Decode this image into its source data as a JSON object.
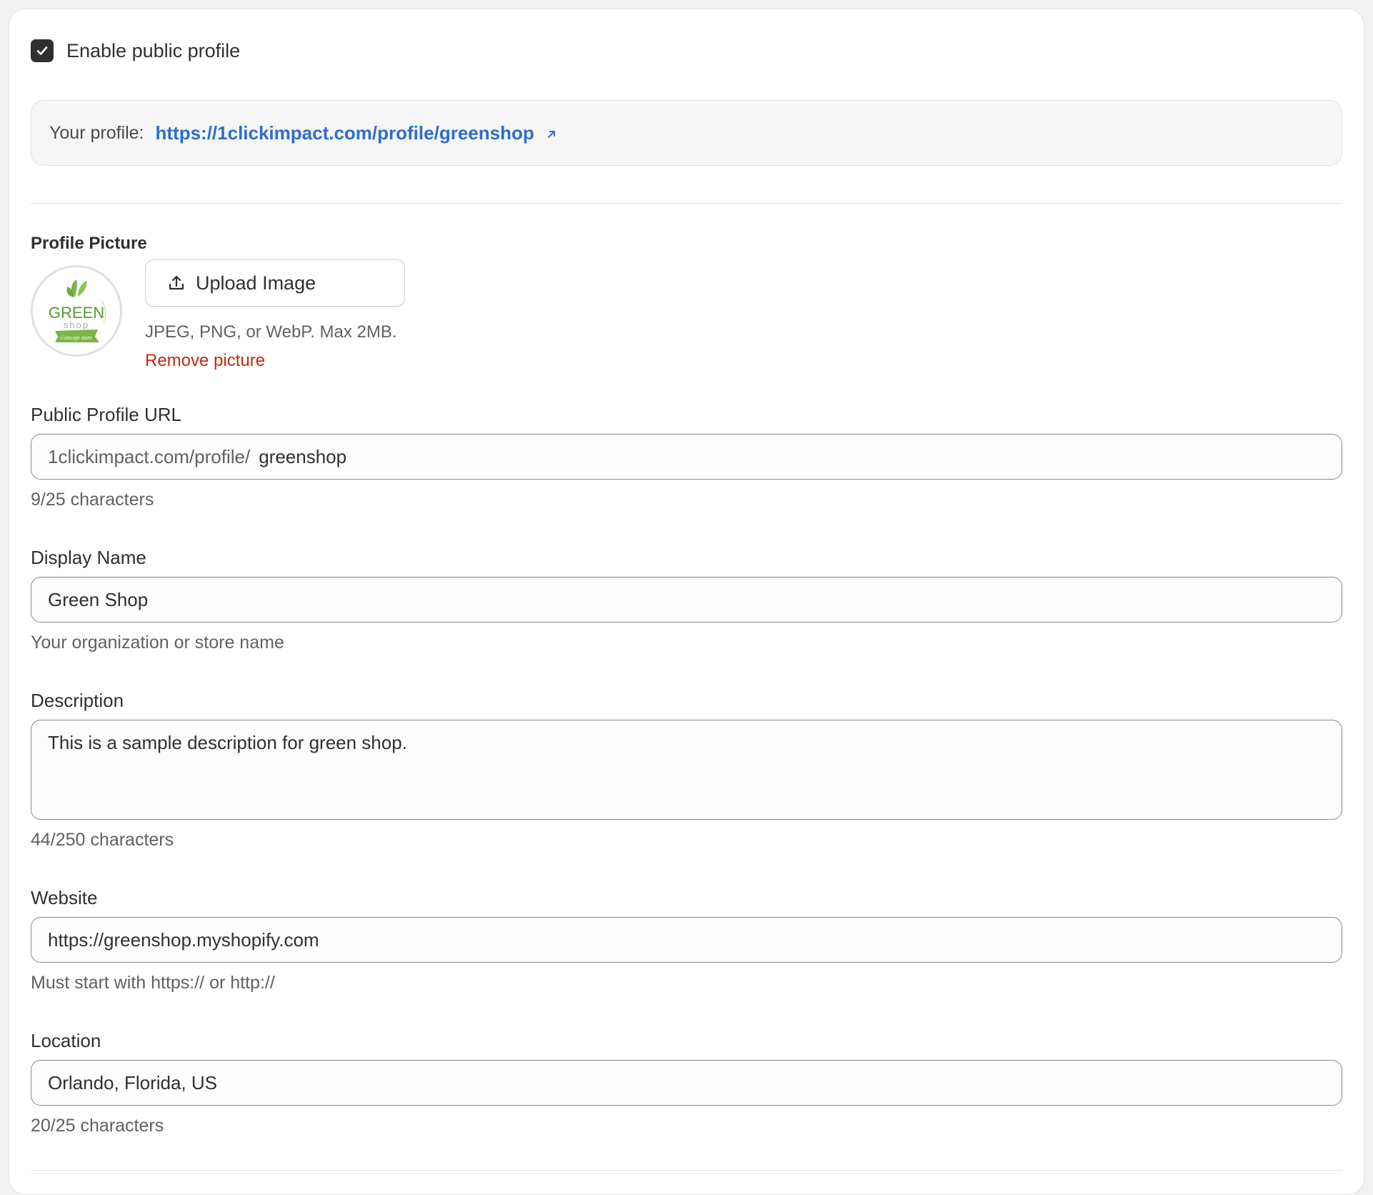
{
  "enable": {
    "label": "Enable public profile",
    "checked": true
  },
  "profile_link": {
    "prefix": "Your profile:",
    "url": "https://1clickimpact.com/profile/greenshop"
  },
  "picture": {
    "title": "Profile Picture",
    "logo_text": "GREEN",
    "logo_subtext": "shop",
    "logo_tagline": "Concept store",
    "upload_label": "Upload Image",
    "hint": "JPEG, PNG, or WebP. Max 2MB.",
    "remove_label": "Remove picture"
  },
  "public_url": {
    "label": "Public Profile URL",
    "prefix": "1clickimpact.com/profile/",
    "value": "greenshop",
    "help": "9/25 characters"
  },
  "display_name": {
    "label": "Display Name",
    "value": "Green Shop",
    "help": "Your organization or store name"
  },
  "description": {
    "label": "Description",
    "value": "This is a sample description for green shop.",
    "help": "44/250 characters"
  },
  "website": {
    "label": "Website",
    "value": "https://greenshop.myshopify.com",
    "help": "Must start with https:// or http://"
  },
  "location": {
    "label": "Location",
    "value": "Orlando, Florida, US",
    "help": "20/25 characters"
  },
  "colors": {
    "link": "#2c6ecb",
    "danger": "#c5280c",
    "brand_green": "#7ab648"
  }
}
